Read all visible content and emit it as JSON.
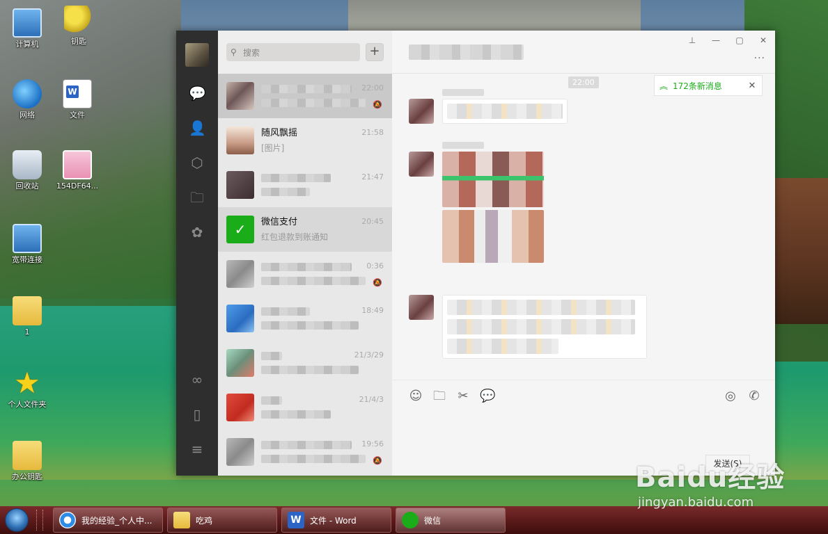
{
  "desktop": {
    "icons": [
      {
        "label": "计算机"
      },
      {
        "label": "钥匙"
      },
      {
        "label": "网络"
      },
      {
        "label": "文件"
      },
      {
        "label": "回收站"
      },
      {
        "label": "154DF64..."
      },
      {
        "label": "宽带连接"
      },
      {
        "label": "1"
      },
      {
        "label": "个人文件夹"
      },
      {
        "label": "办公钥匙"
      }
    ]
  },
  "wechat": {
    "search": {
      "placeholder": "搜索"
    },
    "add_label": "+",
    "chats": [
      {
        "name": "",
        "preview": "",
        "time": "22:00",
        "muted": true
      },
      {
        "name": "随风飘摇",
        "preview": "[图片]",
        "time": "21:58"
      },
      {
        "name": "",
        "preview": "",
        "time": "21:47"
      },
      {
        "name": "微信支付",
        "preview": "红包退款到账通知",
        "time": "20:45"
      },
      {
        "name": "",
        "preview": "",
        "time": "0:36",
        "muted": true
      },
      {
        "name": "",
        "preview": "",
        "time": "18:49"
      },
      {
        "name": "",
        "preview": "",
        "time": "21/3/29"
      },
      {
        "name": "",
        "preview": "",
        "time": "21/4/3"
      },
      {
        "name": "",
        "preview": "",
        "time": "19:56",
        "muted": true
      }
    ],
    "conversation": {
      "time_divider": "22:00",
      "new_messages": "172条新消息",
      "send_label": "发送(S)"
    },
    "window_controls": [
      "⊥",
      "—",
      "▢",
      "✕"
    ],
    "more_label": "···"
  },
  "taskbar": {
    "items": [
      {
        "label": "我的经验_个人中..."
      },
      {
        "label": "吃鸡"
      },
      {
        "label": "文件 - Word"
      },
      {
        "label": "微信"
      }
    ]
  },
  "watermark": {
    "brand": "Baidu经验",
    "url": "jingyan.baidu.com"
  },
  "colors": {
    "wechat_green": "#1aad19",
    "nav_bg": "#2e2e2e",
    "list_bg": "#e8e8e8",
    "taskbar": "#5c1a1a"
  }
}
